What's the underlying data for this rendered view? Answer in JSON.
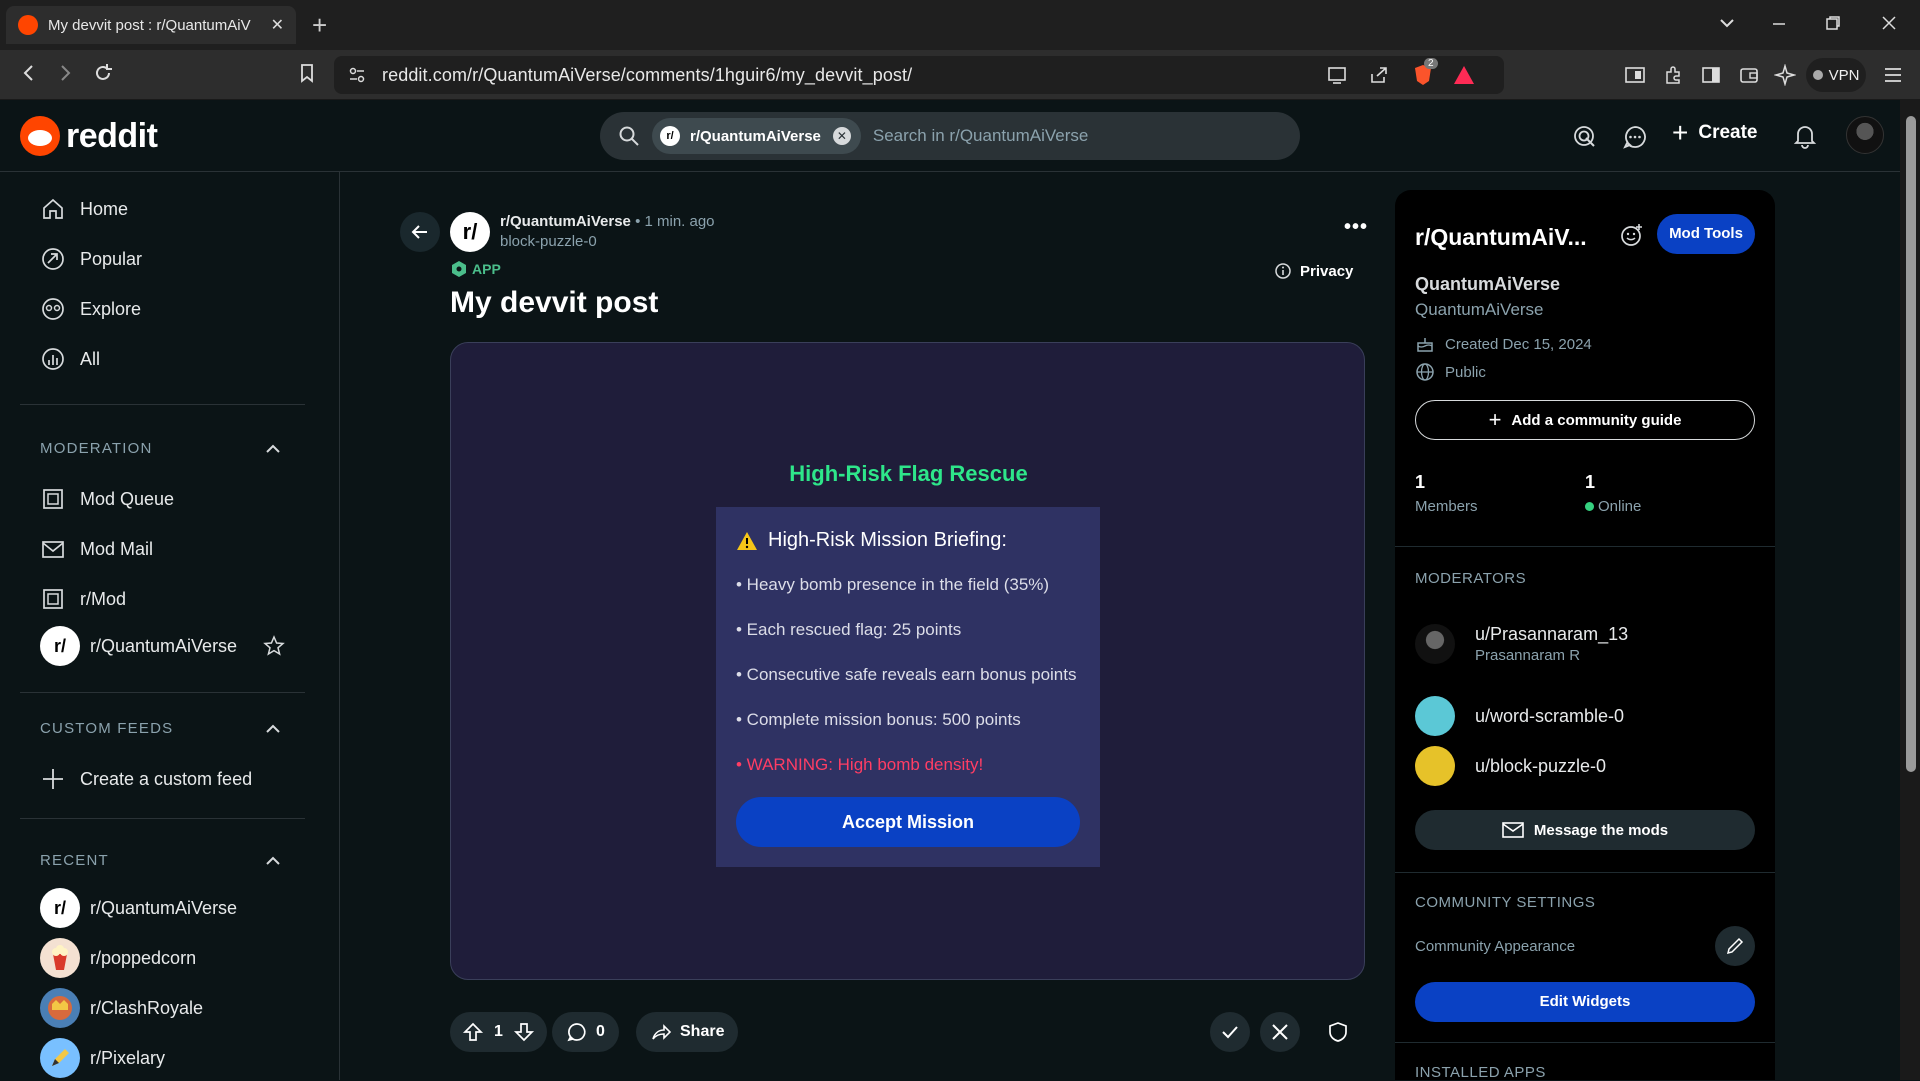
{
  "browser": {
    "tab_title": "My devvit post : r/QuantumAiV",
    "tab_close": "✕",
    "new_tab": "+",
    "url": "reddit.com/r/QuantumAiVerse/comments/1hguir6/my_devvit_post/",
    "vpn_label": "VPN",
    "brave_badge": "2"
  },
  "header": {
    "logo_text": "reddit",
    "search_chip": "r/QuantumAiVerse",
    "search_placeholder": "Search in r/QuantumAiVerse",
    "create_label": "Create"
  },
  "leftnav": {
    "main": [
      {
        "label": "Home",
        "icon": "home-icon"
      },
      {
        "label": "Popular",
        "icon": "popular-icon"
      },
      {
        "label": "Explore",
        "icon": "explore-icon"
      },
      {
        "label": "All",
        "icon": "all-icon"
      }
    ],
    "moderation_header": "MODERATION",
    "moderation": [
      {
        "label": "Mod Queue",
        "icon": "mod-queue-icon"
      },
      {
        "label": "Mod Mail",
        "icon": "mod-mail-icon"
      },
      {
        "label": "r/Mod",
        "icon": "mod-icon"
      },
      {
        "label": "r/QuantumAiVerse",
        "icon": "subreddit-avatar"
      }
    ],
    "custom_feeds_header": "CUSTOM FEEDS",
    "create_custom_feed": "Create a custom feed",
    "recent_header": "RECENT",
    "recent": [
      {
        "label": "r/QuantumAiVerse",
        "color": "#ffffff"
      },
      {
        "label": "r/poppedcorn",
        "color": "#f4e1d2"
      },
      {
        "label": "r/ClashRoyale",
        "color": "#4a7fb5"
      },
      {
        "label": "r/Pixelary",
        "color": "#79c0ff"
      }
    ]
  },
  "post": {
    "subreddit": "r/QuantumAiVerse",
    "time": "• 1 min. ago",
    "author": "block-puzzle-0",
    "app_badge": "APP",
    "privacy": "Privacy",
    "title": "My devvit post",
    "more": "•••",
    "vote_count": "1",
    "comment_count": "0",
    "share_label": "Share"
  },
  "game": {
    "title": "High-Risk Flag Rescue",
    "briefing_title": "High-Risk Mission Briefing:",
    "lines": [
      "• Heavy bomb presence in the field (35%)",
      "• Each rescued flag: 25 points",
      "• Consecutive safe reveals earn bonus points",
      "• Complete mission bonus: 500 points"
    ],
    "warning": "• WARNING: High bomb density!",
    "accept_label": "Accept Mission",
    "colors": {
      "title": "#2ee68a",
      "warning": "#ff3d64",
      "button": "#0a41c4"
    }
  },
  "community": {
    "short_name": "r/QuantumAiV...",
    "mod_tools": "Mod Tools",
    "display_name": "QuantumAiVerse",
    "subtitle": "QuantumAiVerse",
    "created": "Created Dec 15, 2024",
    "visibility": "Public",
    "add_guide": "Add a community guide",
    "members_count": "1",
    "members_label": "Members",
    "online_count": "1",
    "online_label": "Online",
    "moderators_header": "MODERATORS",
    "moderators": [
      {
        "name": "u/Prasannaram_13",
        "sub": "Prasannaram R",
        "color": "#222222"
      },
      {
        "name": "u/word-scramble-0",
        "sub": "",
        "color": "#5bc8d6"
      },
      {
        "name": "u/block-puzzle-0",
        "sub": "",
        "color": "#e6c229"
      }
    ],
    "message_mods": "Message the mods",
    "settings_header": "COMMUNITY SETTINGS",
    "appearance": "Community Appearance",
    "edit_widgets": "Edit Widgets",
    "installed_apps": "INSTALLED APPS"
  }
}
